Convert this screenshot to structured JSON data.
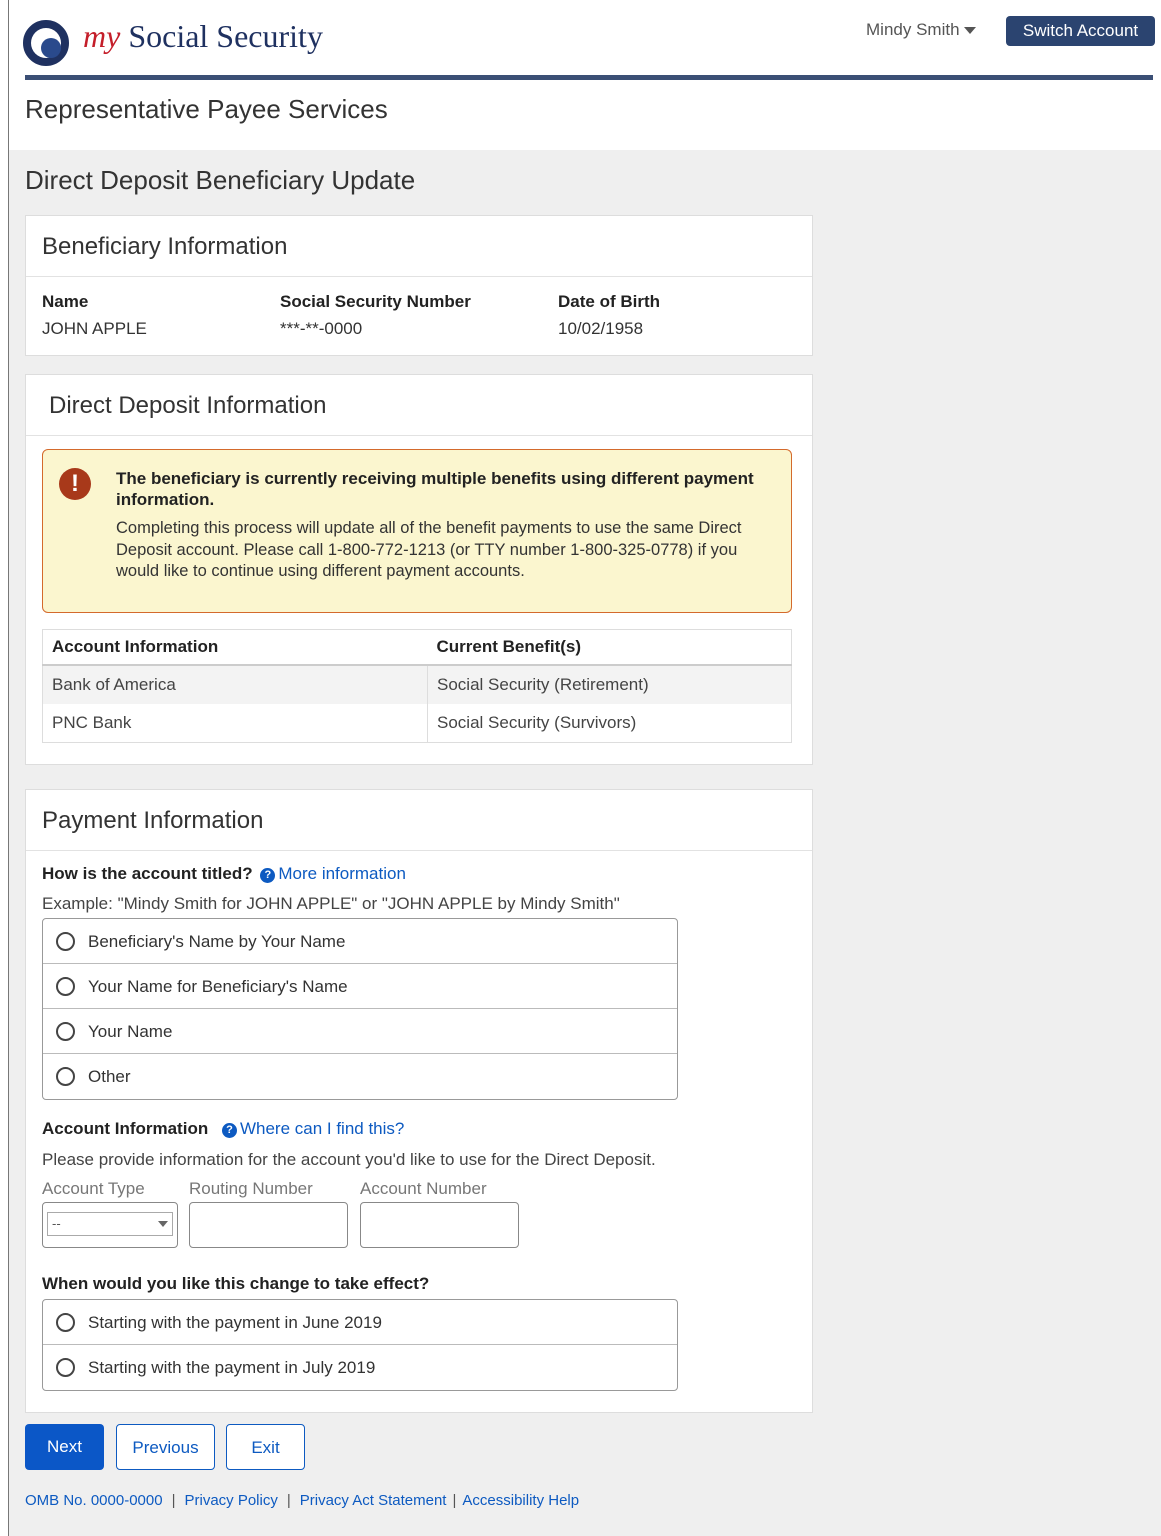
{
  "header": {
    "logo_my": "my",
    "logo_name": "Social Security",
    "user_name": "Mindy Smith",
    "switch_account": "Switch Account",
    "section_title": "Representative Payee Services"
  },
  "page_title": "Direct Deposit Beneficiary Update",
  "beneficiary": {
    "heading": "Beneficiary Information",
    "name_label": "Name",
    "name_value": "JOHN APPLE",
    "ssn_label": "Social Security Number",
    "ssn_value": "***-**-0000",
    "dob_label": "Date of Birth",
    "dob_value": "10/02/1958"
  },
  "direct_deposit": {
    "heading": "Direct Deposit Information",
    "alert_icon": "!",
    "alert_bold": "The beneficiary is currently receiving multiple benefits using different payment information.",
    "alert_body": "Completing this process will update all of the benefit payments to use the same Direct Deposit account.  Please call 1-800-772-1213 (or TTY number 1-800-325-0778) if you would like to continue using different payment accounts.",
    "table": {
      "headers": [
        "Account Information",
        "Current Benefit(s)"
      ],
      "rows": [
        [
          "Bank of America",
          "Social Security (Retirement)"
        ],
        [
          "PNC Bank",
          "Social Security (Survivors)"
        ]
      ]
    }
  },
  "payment": {
    "heading": "Payment Information",
    "title_question": "How is the account titled?",
    "more_info": "More information",
    "example": "Example: \"Mindy Smith for JOHN APPLE\" or \"JOHN APPLE by Mindy Smith\"",
    "title_options": [
      "Beneficiary's Name by Your Name",
      "Your Name for Beneficiary's Name",
      "Your Name",
      "Other"
    ],
    "account_info_label": "Account Information",
    "where_find": "Where can I find this?",
    "account_hint": "Please provide information for the account you'd like to use for the Direct Deposit.",
    "account_type_label": "Account Type",
    "account_type_value": "--",
    "routing_label": "Routing Number",
    "account_number_label": "Account Number",
    "effect_question": "When would you like this change to take effect?",
    "effect_options": [
      "Starting with the payment in June 2019",
      "Starting with the payment in July 2019"
    ]
  },
  "buttons": {
    "next": "Next",
    "previous": "Previous",
    "exit": "Exit"
  },
  "footer": {
    "omb": "OMB No. 0000-0000",
    "privacy_policy": "Privacy Policy",
    "privacy_act": "Privacy Act Statement",
    "accessibility": "Accessibility Help",
    "separator": "|"
  },
  "colors": {
    "brand_navy": "#1f3160",
    "brand_red": "#c41e2a",
    "link_blue": "#0d5ac1",
    "alert_bg": "#fbf6cf",
    "alert_border": "#d46a2c"
  }
}
